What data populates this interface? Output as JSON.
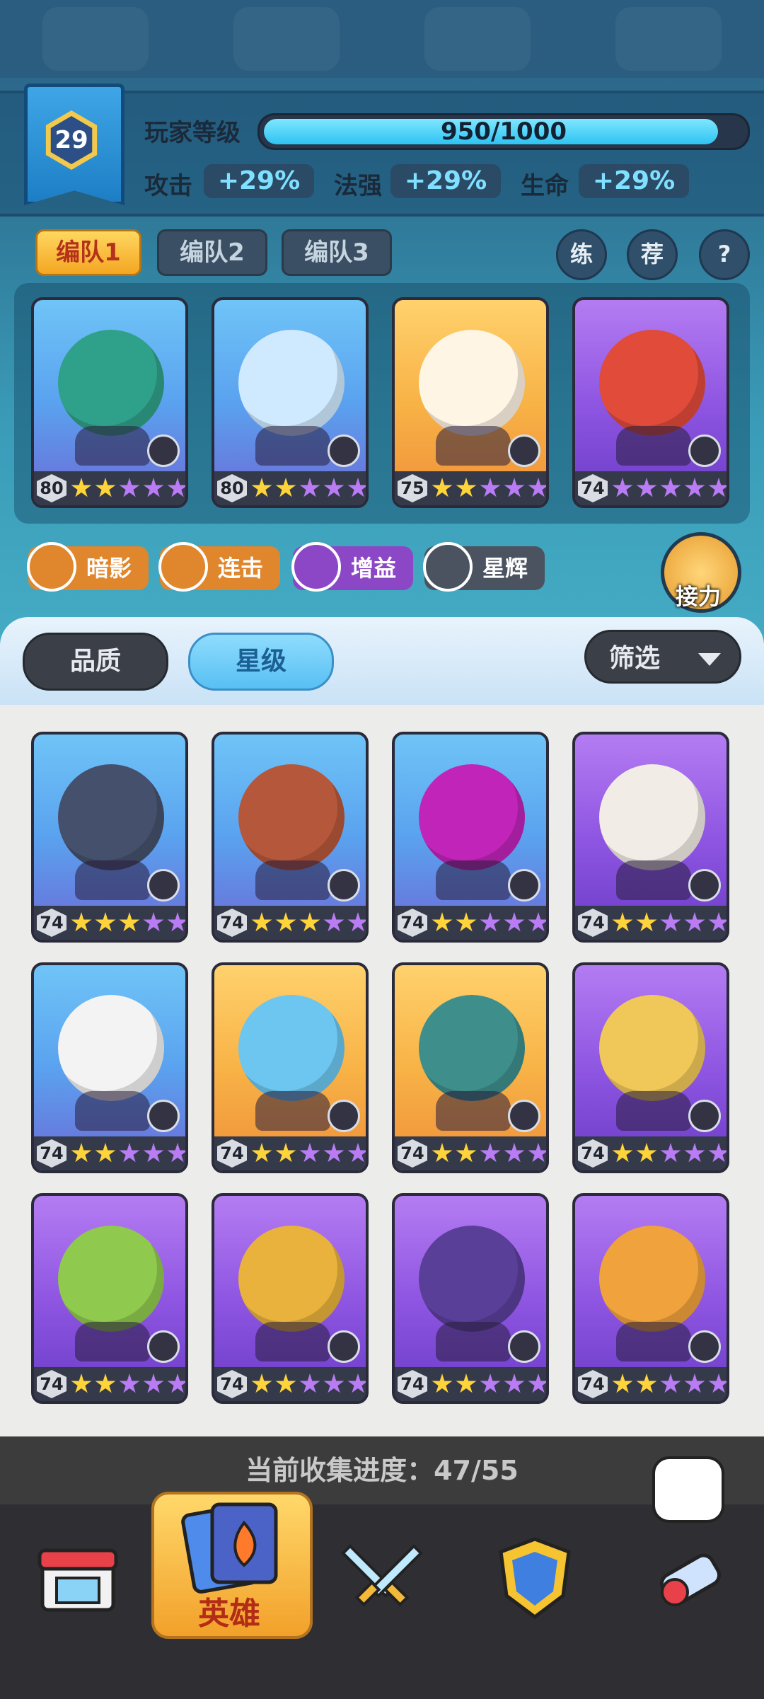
{
  "player": {
    "level": "29",
    "level_label": "玩家等级",
    "xp_text": "950/1000",
    "xp_progress": 0.95,
    "stats": [
      {
        "label": "攻击",
        "value": "+29%"
      },
      {
        "label": "法强",
        "value": "+29%"
      },
      {
        "label": "生命",
        "value": "+29%"
      }
    ]
  },
  "team_tabs": [
    "编队1",
    "编队2",
    "编队3"
  ],
  "header_buttons": [
    "练",
    "荐",
    "?"
  ],
  "team_cards": [
    {
      "level": "80",
      "stars": 2,
      "color": "blue",
      "tint": "#2fa089"
    },
    {
      "level": "80",
      "stars": 2,
      "color": "blue",
      "tint": "#cfe9ff"
    },
    {
      "level": "75",
      "stars": 2,
      "color": "gold",
      "tint": "#fff5e5"
    },
    {
      "level": "74",
      "stars": 0,
      "color": "purple",
      "tint": "#e04b3a"
    }
  ],
  "factions": [
    {
      "label": "暗影",
      "color": "#e0862c"
    },
    {
      "label": "连击",
      "color": "#e0862c"
    },
    {
      "label": "增益",
      "color": "#8c47c6"
    },
    {
      "label": "星辉",
      "color": "#4b5360"
    }
  ],
  "relay_label": "接力",
  "sort": {
    "quality": "品质",
    "star": "星级",
    "filter": "筛选"
  },
  "hero_grid": [
    {
      "level": "74",
      "stars": 3,
      "color": "blue",
      "tint": "#45506c"
    },
    {
      "level": "74",
      "stars": 3,
      "color": "blue",
      "tint": "#b5573a"
    },
    {
      "level": "74",
      "stars": 2,
      "color": "blue",
      "tint": "#c024b8"
    },
    {
      "level": "74",
      "stars": 2,
      "color": "purple",
      "tint": "#f2ece6"
    },
    {
      "level": "74",
      "stars": 2,
      "color": "blue",
      "tint": "#f3f3f3"
    },
    {
      "level": "74",
      "stars": 2,
      "color": "gold",
      "tint": "#6cc6ef"
    },
    {
      "level": "74",
      "stars": 2,
      "color": "gold",
      "tint": "#3e8f8c"
    },
    {
      "level": "74",
      "stars": 2,
      "color": "purple",
      "tint": "#f0c85a"
    },
    {
      "level": "74",
      "stars": 2,
      "color": "purple",
      "tint": "#8fc94e"
    },
    {
      "level": "74",
      "stars": 2,
      "color": "purple",
      "tint": "#e8b23c"
    },
    {
      "level": "74",
      "stars": 2,
      "color": "purple",
      "tint": "#5a3f99"
    },
    {
      "level": "74",
      "stars": 2,
      "color": "purple",
      "tint": "#f0a23c"
    }
  ],
  "collection_progress": "当前收集进度：47/55",
  "nav": {
    "heroes_label": "英雄"
  }
}
